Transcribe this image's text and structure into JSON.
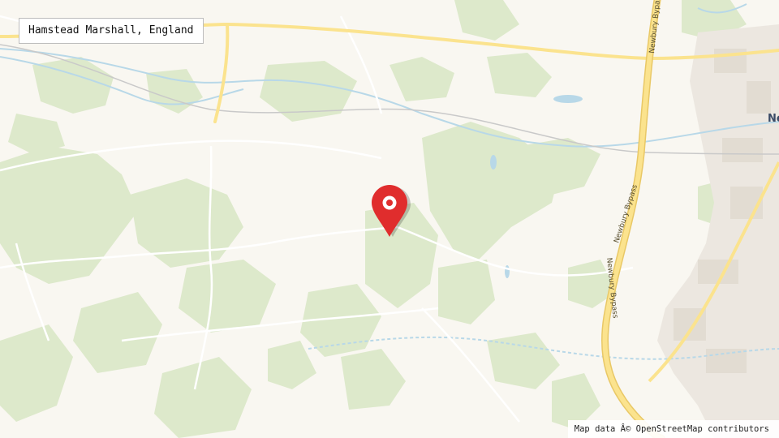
{
  "location": {
    "name": "Hamstead Marshall, England"
  },
  "map": {
    "attribution": "Map data Â© OpenStreetMap contributors",
    "town_label": "Ne",
    "road_labels": [
      "Newbury Bypass",
      "Newbury Bypass",
      "Newbury Bypass"
    ],
    "marker_icon": "map-pin-icon",
    "colors": {
      "background": "#f9f7f1",
      "woodland": "#dde9cb",
      "river": "#b8d8e8",
      "major_road": "#fbe38e",
      "minor_road": "#ffffff",
      "urban": "#ece7e0",
      "marker": "#e02d2d"
    }
  }
}
